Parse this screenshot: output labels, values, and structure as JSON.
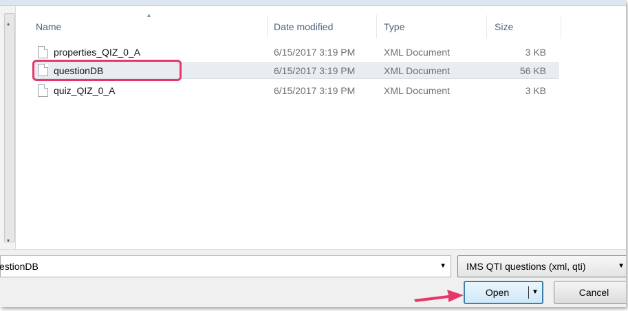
{
  "columns": {
    "name": "Name",
    "date_modified": "Date modified",
    "type": "Type",
    "size": "Size"
  },
  "files": [
    {
      "name": "properties_QIZ_0_A",
      "date": "6/15/2017 3:19 PM",
      "type": "XML Document",
      "size": "3 KB"
    },
    {
      "name": "questionDB",
      "date": "6/15/2017 3:19 PM",
      "type": "XML Document",
      "size": "56 KB"
    },
    {
      "name": "quiz_QIZ_0_A",
      "date": "6/15/2017 3:19 PM",
      "type": "XML Document",
      "size": "3 KB"
    }
  ],
  "selected_file": "questionDB",
  "filename_field": {
    "value": "estionDB"
  },
  "filetype_select": {
    "value": "IMS QTI questions (xml, qti)"
  },
  "buttons": {
    "open": "Open",
    "cancel": "Cancel"
  },
  "colors": {
    "highlight": "#e8366b",
    "arrow": "#e8366b",
    "open_border": "#3c7fb1"
  }
}
